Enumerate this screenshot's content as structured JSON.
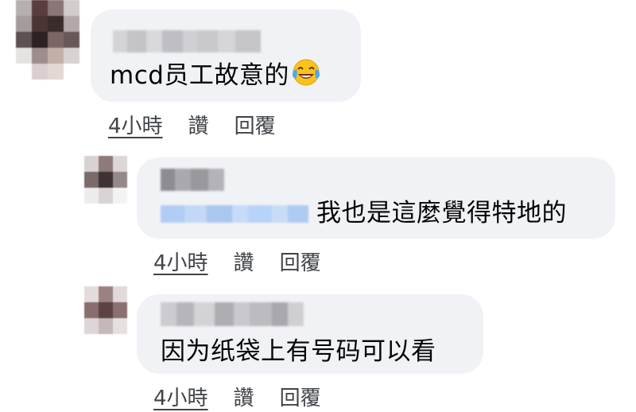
{
  "comments": [
    {
      "text": "mcd员工故意的",
      "emoji": "face-with-tears-of-joy-icon",
      "time": "4小時",
      "like": "讚",
      "reply": "回覆"
    },
    {
      "text": "我也是這麼覺得特地的",
      "time": "4小時",
      "like": "讚",
      "reply": "回覆"
    },
    {
      "text": "因为纸袋上有号码可以看",
      "time": "4小時",
      "like": "讚",
      "reply": "回覆"
    }
  ],
  "colors": {
    "bubble": "#f0f2f5",
    "action_text": "#404348",
    "mention_blue": "#b7d3f7"
  }
}
